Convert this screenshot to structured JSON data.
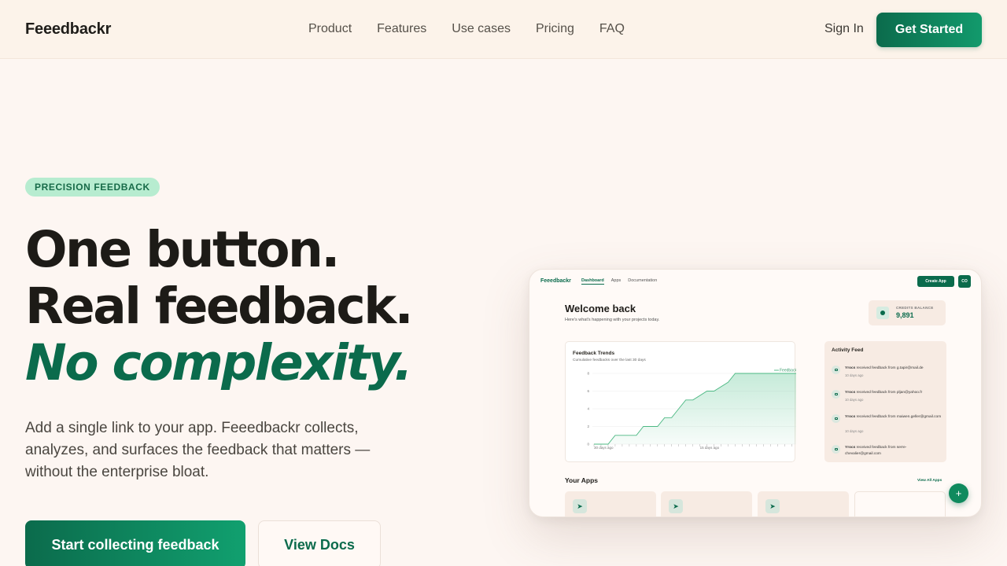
{
  "brand": "Feeedbackr",
  "nav": {
    "links": [
      "Product",
      "Features",
      "Use cases",
      "Pricing",
      "FAQ"
    ],
    "sign_in": "Sign In",
    "get_started": "Get Started"
  },
  "hero": {
    "badge": "PRECISION FEEDBACK",
    "headline_line1": "One button.",
    "headline_line2": "Real feedback.",
    "headline_line3": "No complexity.",
    "subtext": "Add a single link to your app. Feeedbackr collects, analyzes, and surfaces the feedback that matters — without the enterprise bloat.",
    "cta_primary": "Start collecting feedback",
    "cta_secondary": "View Docs"
  },
  "preview": {
    "brand": "Feeedbackr",
    "nav": [
      "Dashboard",
      "Apps",
      "Documentation"
    ],
    "create_app": "Create App",
    "avatar": "CO",
    "welcome_title": "Welcome back",
    "welcome_sub": "Here's what's happening with your projects today.",
    "credits_label": "CREDITS BALANCE",
    "credits_value": "9,891",
    "chart_title": "Feedback Trends",
    "chart_sub": "Cumulative feedbacks over the last 30 days",
    "activity_title": "Activity Feed",
    "activity": [
      {
        "app": "Yrocs",
        "text": " received feedback from g.tapir@mail.de",
        "time": "10 days ago"
      },
      {
        "app": "Yrocs",
        "text": " received feedback from pljan@yahoo.fr",
        "time": "10 days ago"
      },
      {
        "app": "Yrocs",
        "text": " received feedback from maiwen.geller@gmail.com",
        "time": "10 days ago"
      },
      {
        "app": "Yrocs",
        "text": " received feedback from serre-chevalier@gmail.com",
        "time": ""
      }
    ],
    "apps_title": "Your Apps",
    "view_all": "View All Apps",
    "app_icon": "rocket-icon",
    "fab_icon": "plus-icon"
  },
  "colors": {
    "accent": "#0b6b4c",
    "accent_light": "#129a6c",
    "badge_bg": "#b7ecd0",
    "background": "#fdf6f2"
  },
  "chart_data": {
    "type": "line",
    "title": "Feedback Trends",
    "subtitle": "Cumulative feedbacks over the last 30 days",
    "series": [
      {
        "name": "Feedbacks",
        "x": [
          0,
          2,
          3,
          6,
          7,
          9,
          10,
          11,
          12,
          13,
          14,
          16,
          17,
          19,
          20,
          30
        ],
        "values": [
          0,
          0,
          1,
          1,
          2,
          2,
          3,
          3,
          4,
          5,
          5,
          6,
          6,
          7,
          8,
          8
        ]
      }
    ],
    "yticks": [
      "0",
      "2",
      "4",
      "6",
      "8"
    ],
    "xtick_labels": [
      "30 days ago",
      "15 days ago"
    ],
    "ylim": [
      0,
      8
    ],
    "xlim": [
      0,
      30
    ],
    "grid": true,
    "legend": "top-right"
  }
}
